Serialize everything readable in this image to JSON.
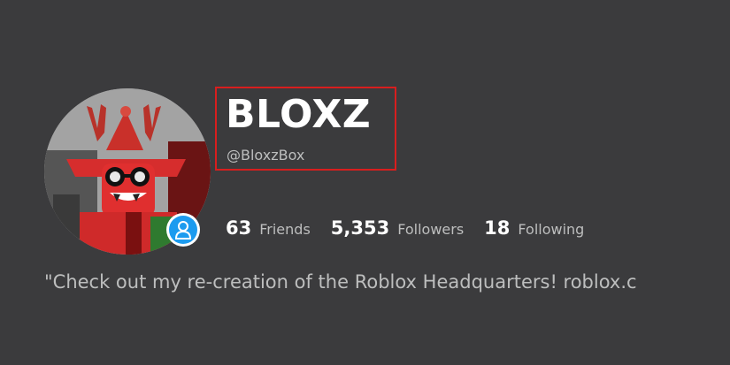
{
  "profile": {
    "display_name": "BLOXZ",
    "username": "@BloxzBox",
    "bio": "\"Check out my re-creation of the Roblox Headquarters! roblox.c",
    "avatar_icon": "roblox-avatar-image",
    "badge_icon": "user-icon"
  },
  "stats": [
    {
      "count": "63",
      "label": "Friends"
    },
    {
      "count": "5,353",
      "label": "Followers"
    },
    {
      "count": "18",
      "label": "Following"
    }
  ],
  "colors": {
    "background": "#3b3b3d",
    "highlight_border": "#d81e1e",
    "badge_blue": "#1c9bef",
    "text_primary": "#ffffff",
    "text_secondary": "#bdbebe"
  }
}
